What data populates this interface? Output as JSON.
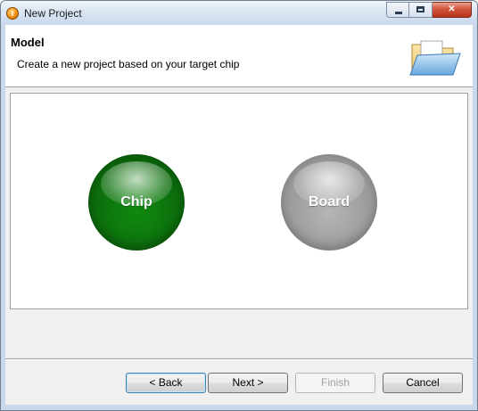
{
  "window": {
    "title": "New Project",
    "controls": {
      "minimize": "minimize",
      "maximize": "maximize",
      "close": "close"
    }
  },
  "header": {
    "title": "Model",
    "description": "Create a new project based on your target chip",
    "icon": "folder-open-icon"
  },
  "options": [
    {
      "label": "Chip",
      "color": "#0c6e0c",
      "state": "selected"
    },
    {
      "label": "Board",
      "color": "#999999",
      "state": "unselected"
    }
  ],
  "buttons": {
    "back": "< Back",
    "next": "Next >",
    "finish": "Finish",
    "cancel": "Cancel"
  },
  "colors": {
    "titlebar": "#dbe6f3",
    "close_button": "#d2533b",
    "default_button_border": "#3c7fb1"
  }
}
